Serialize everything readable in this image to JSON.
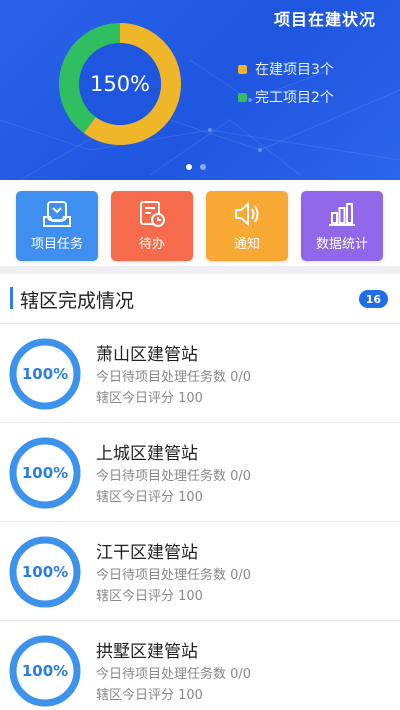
{
  "banner": {
    "title": "项目在建状况",
    "percent": "150%",
    "in_progress_count": 3,
    "completed_count": 2,
    "legend": [
      {
        "label": "在建项目3个",
        "color": "#f0b62a"
      },
      {
        "label": "完工项目2个",
        "color": "#2fbf60"
      }
    ],
    "page_indicator": {
      "total": 2,
      "active": 1
    },
    "colors": {
      "background": "#2560e6",
      "ring_inner": "#1f56e0"
    }
  },
  "quick_actions": [
    {
      "label": "项目任务",
      "icon": "project-task-icon",
      "color": "#3e8ff0"
    },
    {
      "label": "待办",
      "icon": "todo-clock-icon",
      "color": "#f56b4c"
    },
    {
      "label": "通知",
      "icon": "speaker-icon",
      "color": "#f7a934"
    },
    {
      "label": "数据统计",
      "icon": "bar-chart-icon",
      "color": "#8f67e8"
    }
  ],
  "section": {
    "title": "辖区完成情况",
    "count": "16",
    "accent": "#2f7fe9"
  },
  "stations": [
    {
      "name": "萧山区建管站",
      "percent": "100%",
      "completion": 1.0,
      "tasks": "今日待项目处理任务数 0/0",
      "score": "辖区今日评分 100"
    },
    {
      "name": "上城区建管站",
      "percent": "100%",
      "completion": 1.0,
      "tasks": "今日待项目处理任务数 0/0",
      "score": "辖区今日评分 100"
    },
    {
      "name": "江干区建管站",
      "percent": "100%",
      "completion": 1.0,
      "tasks": "今日待项目处理任务数 0/0",
      "score": "辖区今日评分 100"
    },
    {
      "name": "拱墅区建管站",
      "percent": "100%",
      "completion": 1.0,
      "tasks": "今日待项目处理任务数 0/0",
      "score": "辖区今日评分 100"
    }
  ]
}
